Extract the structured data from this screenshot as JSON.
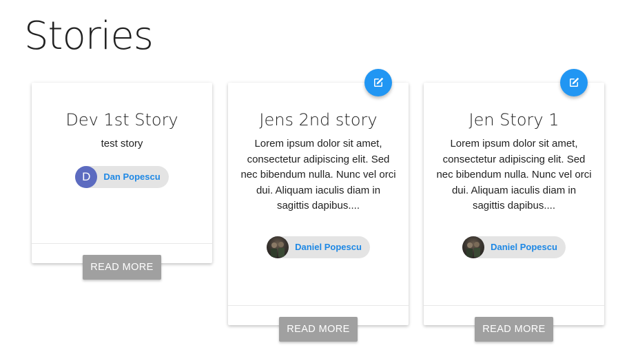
{
  "page": {
    "title": "Stories"
  },
  "cards": [
    {
      "title": "Dev 1st Story",
      "text": "test story",
      "author": {
        "name": "Dan Popescu",
        "avatar_letter": "D",
        "avatar_type": "letter"
      },
      "button_label": "READ MORE",
      "editable": false
    },
    {
      "title": "Jens 2nd story",
      "text": "Lorem ipsum dolor sit amet, consectetur adipiscing elit. Sed nec bibendum nulla. Nunc vel orci dui. Aliquam iaculis diam in sagittis dapibus....",
      "author": {
        "name": "Daniel Popescu",
        "avatar_type": "photo"
      },
      "button_label": "READ MORE",
      "editable": true,
      "edit_icon": "edit-icon"
    },
    {
      "title": "Jen Story 1",
      "text": "Lorem ipsum dolor sit amet, consectetur adipiscing elit. Sed nec bibendum nulla. Nunc vel orci dui. Aliquam iaculis diam in sagittis dapibus....",
      "author": {
        "name": "Daniel Popescu",
        "avatar_type": "photo"
      },
      "button_label": "READ MORE",
      "editable": true,
      "edit_icon": "edit-icon"
    }
  ],
  "colors": {
    "fab": "#2196f3",
    "chip_text": "#1e88e5",
    "chip_bg": "#e4e4e4",
    "avatar_letter_bg": "#5c6bc0",
    "button_bg": "#a0a0a0"
  }
}
